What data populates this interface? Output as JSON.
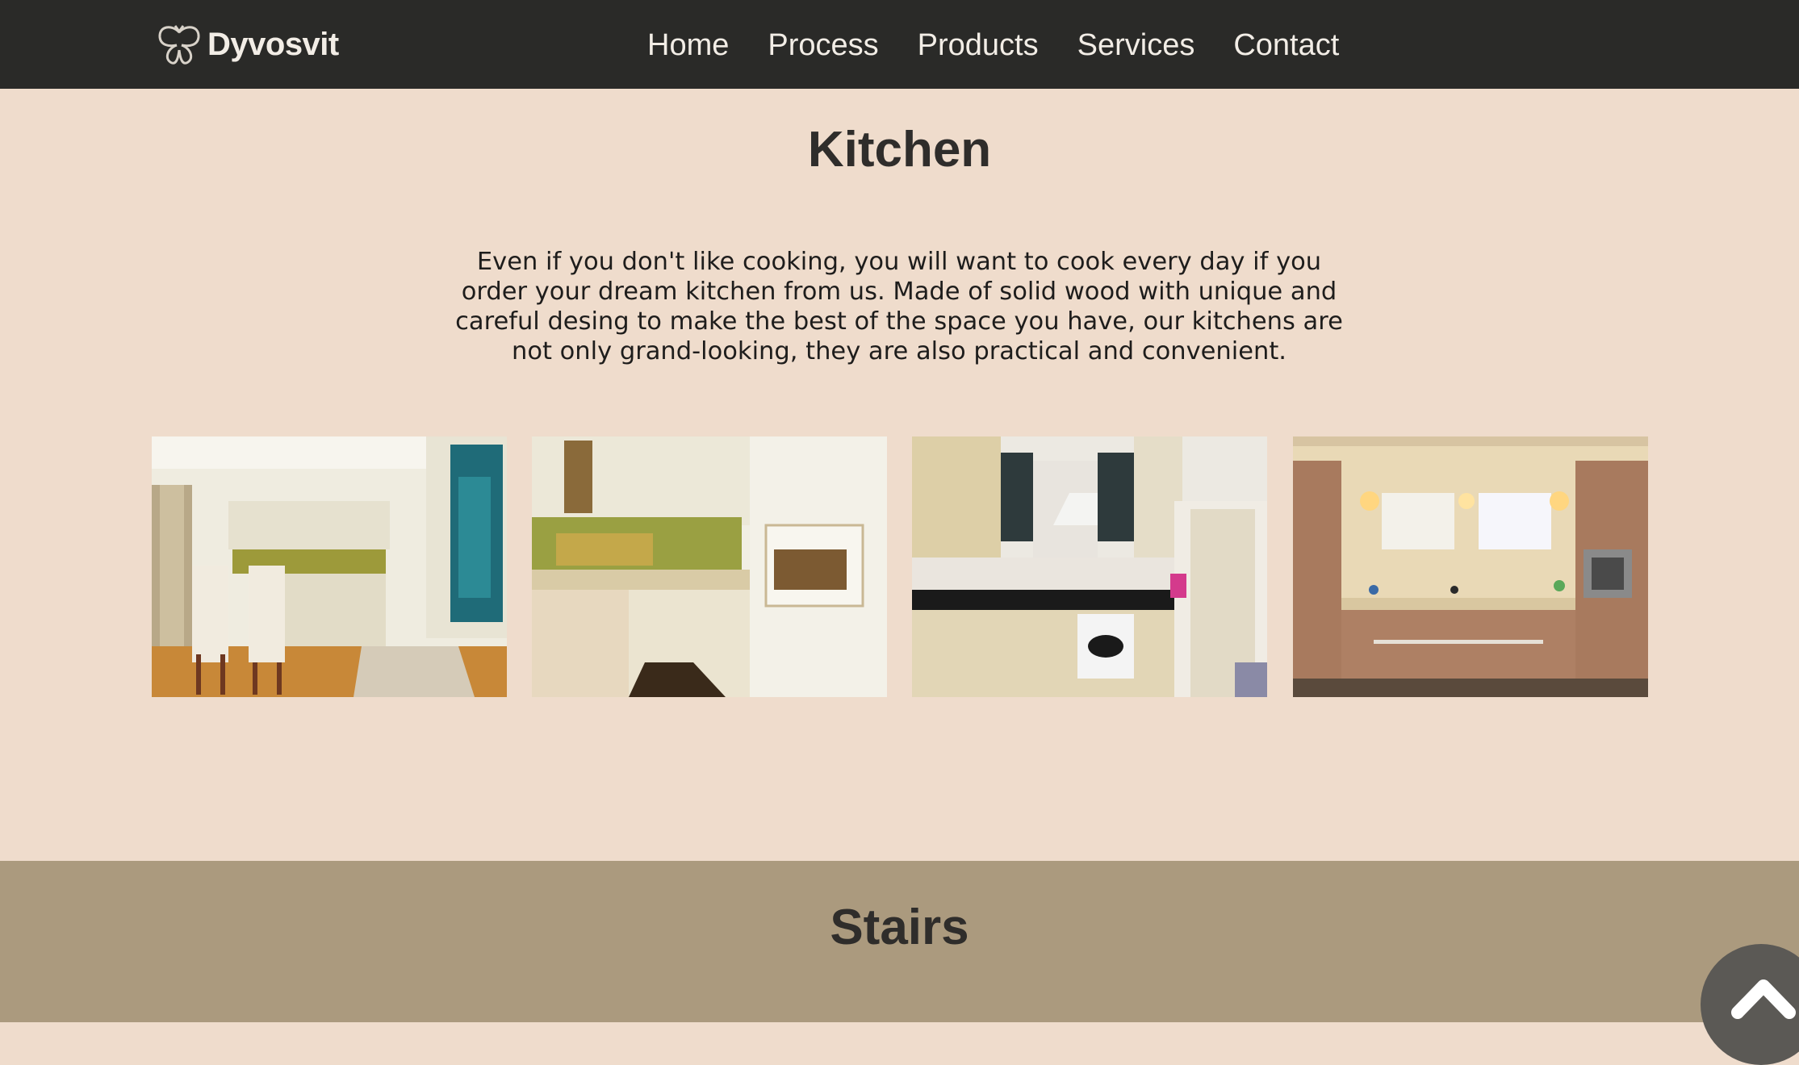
{
  "header": {
    "brand": "Dyvosvit",
    "logo_icon": "butterfly-logo-icon",
    "nav": [
      {
        "label": "Home"
      },
      {
        "label": "Process"
      },
      {
        "label": "Products"
      },
      {
        "label": "Services"
      },
      {
        "label": "Contact"
      }
    ]
  },
  "kitchen": {
    "title": "Kitchen",
    "description": "Even if you don't like cooking, you will want to cook every day if you order your dream kitchen from us. Made of solid wood with unique and careful desing to make the best of the space you have, our kitchens are not only grand-looking, they are also practical and convenient."
  },
  "stairs": {
    "title": "Stairs"
  },
  "back_to_top": {
    "icon": "chevron-up-icon"
  },
  "colors": {
    "header_bg": "#2a2a28",
    "page_bg": "#efdccc",
    "stairs_bg": "#ab9a7e",
    "text_dark": "#2f2d2b"
  }
}
